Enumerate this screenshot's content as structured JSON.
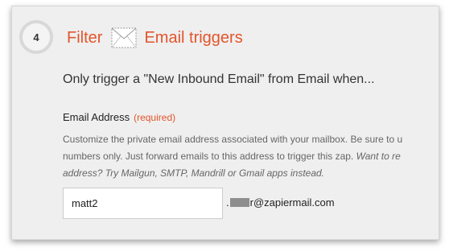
{
  "step": {
    "number": "4"
  },
  "header": {
    "filter_label": "Filter",
    "icon": "envelope-icon",
    "title": "Email triggers"
  },
  "subtitle": "Only trigger a \"New Inbound Email\" from Email when...",
  "field": {
    "label": "Email Address",
    "required": "(required)",
    "help_line1": "Customize the private email address associated with your mailbox. Be sure to u",
    "help_line2_plain": "numbers only. Just forward emails to this address to trigger this zap. ",
    "help_line2_italic": "Want to re",
    "help_line3_italic": "address? Try Mailgun, SMTP, Mandrill or Gmail apps instead.",
    "input_value": "matt2",
    "suffix_prefix": ".",
    "suffix_rest": "r@zapiermail.com"
  },
  "colors": {
    "accent": "#e2552b",
    "panel_bg": "#efefef"
  }
}
